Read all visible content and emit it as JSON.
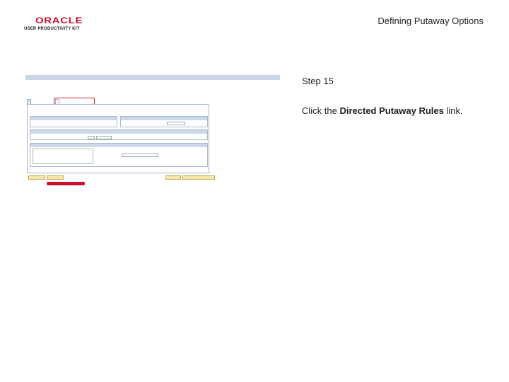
{
  "slide": {
    "logo_word": "ORACLE",
    "logo_reg": "®",
    "logo_sub": "USER PRODUCTIVITY KIT",
    "title": "Defining Putaway Options",
    "step": "Step 15",
    "instruction_pre": "Click the ",
    "instruction_bold": "Directed Putaway Rules",
    "instruction_post": " link."
  }
}
